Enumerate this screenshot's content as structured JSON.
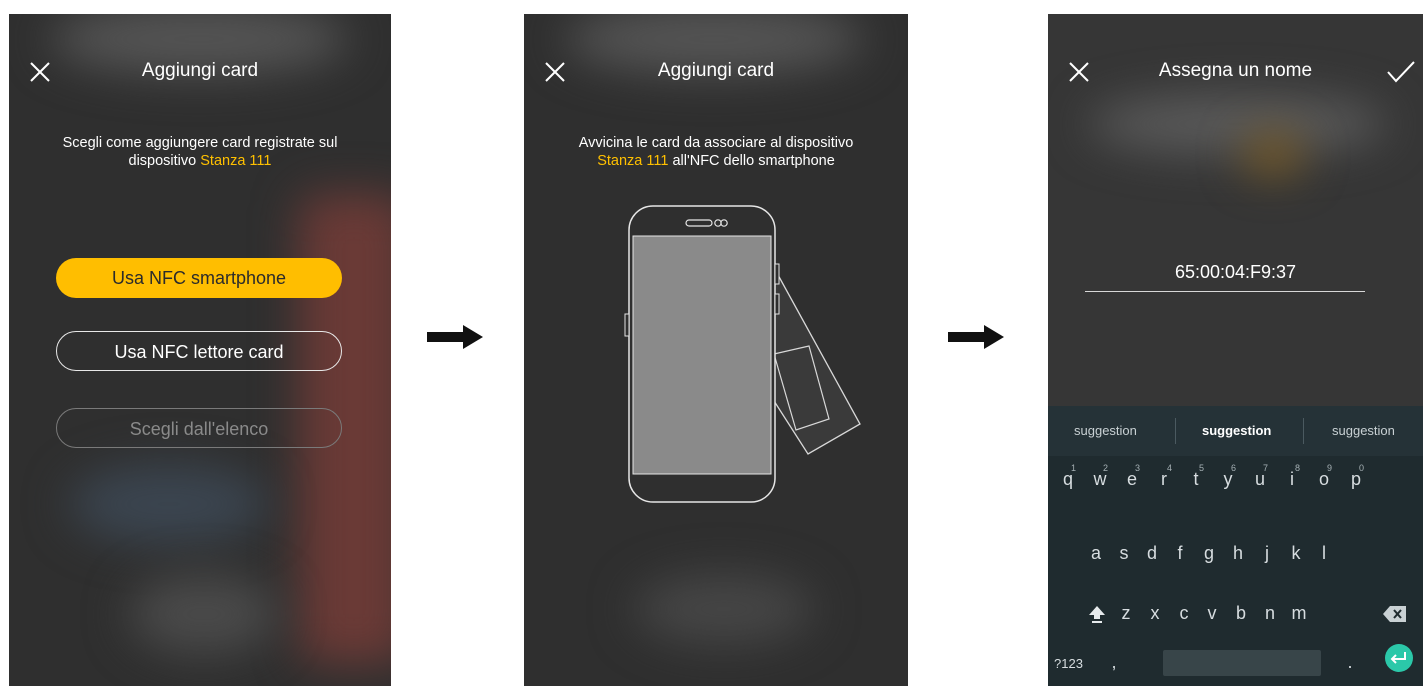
{
  "screen1": {
    "title": "Aggiungi card",
    "desc_line1": "Scegli come aggiungere card registrate sul",
    "desc_line2_prefix": "dispositivo ",
    "device": "Stanza 111",
    "buttons": {
      "nfc_smartphone": "Usa NFC smartphone",
      "nfc_reader": "Usa NFC lettore card",
      "from_list": "Scegli dall'elenco"
    }
  },
  "screen2": {
    "title": "Aggiungi card",
    "desc_line1": "Avvicina le card da associare al dispositivo",
    "device": "Stanza 111",
    "desc_line2_suffix": " all'NFC dello smartphone"
  },
  "screen3": {
    "title": "Assegna un nome",
    "name_value": "65:00:04:F9:37",
    "suggestions": [
      "suggestion",
      "suggestion",
      "suggestion"
    ],
    "keyboard": {
      "row1": [
        "q",
        "w",
        "e",
        "r",
        "t",
        "y",
        "u",
        "i",
        "o",
        "p"
      ],
      "row1_hints": [
        "1",
        "2",
        "3",
        "4",
        "5",
        "6",
        "7",
        "8",
        "9",
        "0"
      ],
      "row2": [
        "a",
        "s",
        "d",
        "f",
        "g",
        "h",
        "j",
        "k",
        "l"
      ],
      "row3": [
        "z",
        "x",
        "c",
        "v",
        "b",
        "n",
        "m"
      ],
      "symbols_key": "?123",
      "comma_key": ",",
      "period_key": "."
    }
  },
  "icons": {
    "close": "close-icon",
    "check": "check-icon",
    "arrow": "right-arrow-icon",
    "shift": "shift-icon",
    "backspace": "backspace-icon",
    "enter": "enter-icon"
  },
  "colors": {
    "accent": "#ffc000",
    "primary_button": "#ffbe00",
    "screen_bg": "#2f2f2f",
    "keyboard_bg": "#1f2b2f",
    "enter_key": "#2bc8a9"
  }
}
